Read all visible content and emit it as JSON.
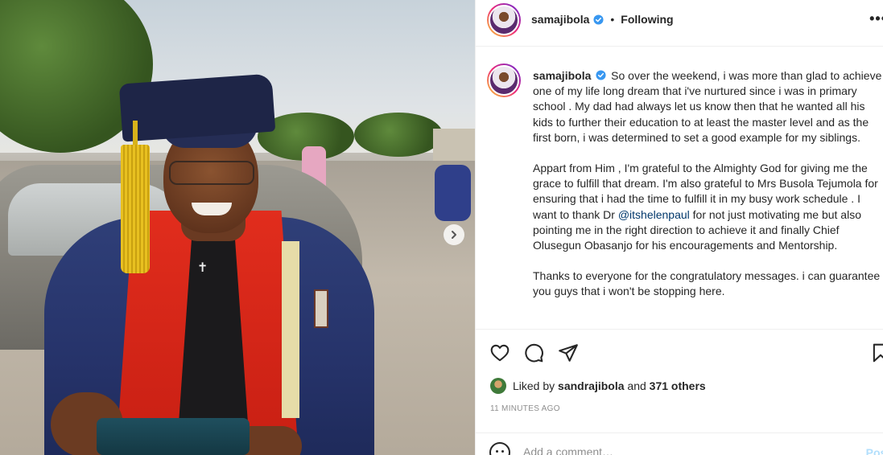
{
  "header": {
    "username": "samajibola",
    "separator": "•",
    "follow_status": "Following",
    "more_label": "•••"
  },
  "caption": {
    "username": "samajibola",
    "paragraphs": [
      "So over the weekend, i was more than glad to achieve one of my life long dream that i've nurtured since i was in primary school . My dad had always let us know then that he wanted all his kids to further their education to at least the master level and as the first born, i was determined to set a good example for my siblings.",
      "Appart from Him , I'm grateful to the Almighty God for giving me the grace to fulfill that dream. I'm also grateful to Mrs Busola Tejumola for ensuring that i had the time to fulfill it in my busy work schedule . I want to thank Dr",
      "for not just motivating me but also pointing me in the right direction to achieve it and finally Chief Olusegun Obasanjo for his encouragements and Mentorship.",
      "Thanks to everyone for the congratulatory messages. i can guarantee you guys that i won't be stopping here."
    ],
    "mention": "@itshelenpaul"
  },
  "likes": {
    "prefix": "Liked by",
    "user": "sandrajibola",
    "conjunction": "and",
    "others": "371 others"
  },
  "timestamp": "11 MINUTES AGO",
  "comment": {
    "placeholder": "Add a comment…",
    "post_label": "Post"
  },
  "icons": {
    "verified": "verified-badge-icon",
    "like": "heart-icon",
    "comment": "comment-bubble-icon",
    "share": "paper-plane-icon",
    "save": "bookmark-icon",
    "emoji": "emoji-icon",
    "next": "chevron-right-icon"
  },
  "colors": {
    "verified_blue": "#3897f0",
    "mention": "#00376b",
    "muted": "#8e8e8e",
    "post_button": "#b2dffc"
  }
}
